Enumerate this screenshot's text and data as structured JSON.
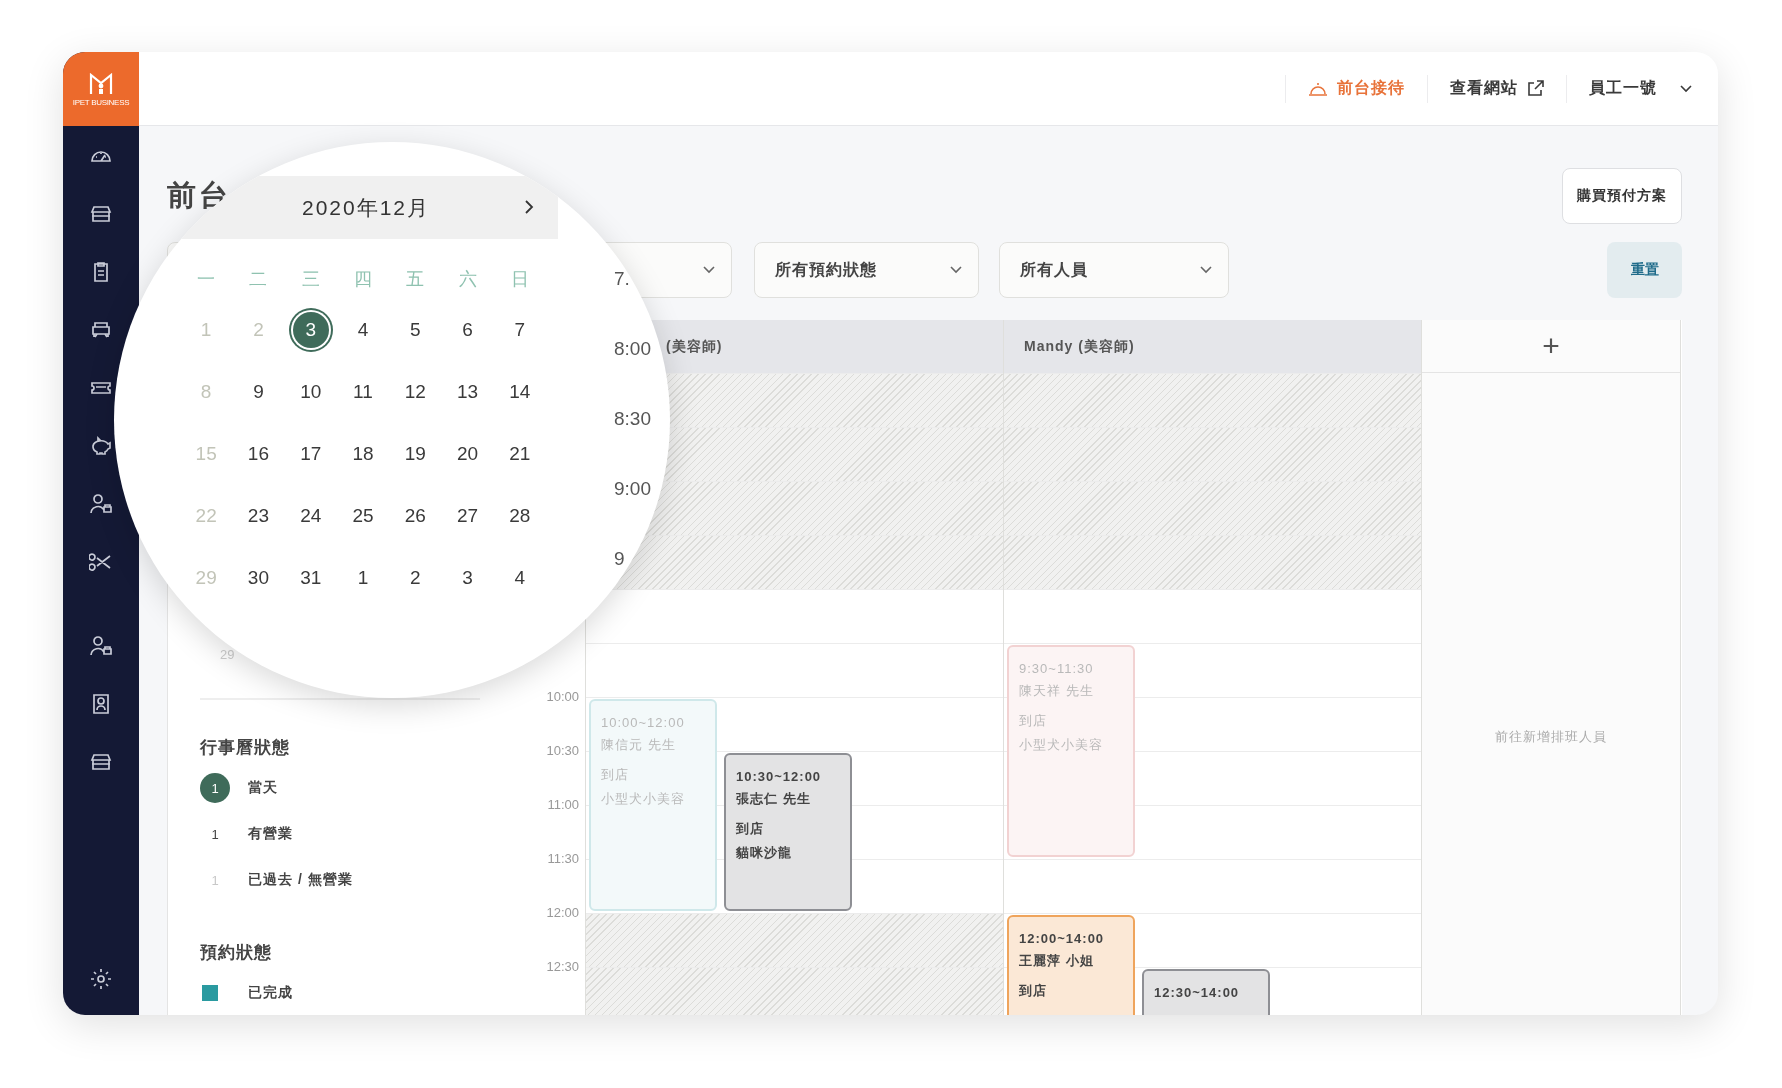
{
  "logo": {
    "caption": "IPET BUSINESS"
  },
  "top_nav": [
    {
      "label": "前台接待",
      "kind": "reception",
      "selected": true
    },
    {
      "label": "查看網站",
      "kind": "external",
      "selected": false
    },
    {
      "label": "員工一號",
      "kind": "account",
      "selected": false
    }
  ],
  "page": {
    "title": "前台",
    "purchase_button": "購買預付方案",
    "reset_button": "重置"
  },
  "filters": [
    {
      "label": "所有預約狀態"
    },
    {
      "label": "所有人員"
    }
  ],
  "mini_calendar_peek": "29",
  "calendar_legend": {
    "title": "行事曆狀態",
    "items": [
      {
        "sample": "1",
        "label": "當天",
        "kind": "today"
      },
      {
        "sample": "1",
        "label": "有營業",
        "kind": "open"
      },
      {
        "sample": "1",
        "label": "已過去 / 無營業",
        "kind": "closed"
      }
    ]
  },
  "booking_legend": {
    "title": "預約狀態",
    "items": [
      {
        "label": "已完成",
        "color": "#2a9aa0"
      }
    ]
  },
  "schedule": {
    "times": [
      "10:00",
      "10:30",
      "11:00",
      "11:30",
      "12:00",
      "12:30"
    ],
    "staff": [
      {
        "header": "(美容師)",
        "blocked_slots": [
          true,
          true,
          true,
          true,
          false,
          false,
          false,
          false,
          false,
          false,
          true,
          true
        ],
        "appointments": [
          {
            "time": "10:00~12:00",
            "lines": [
              "陳信元 先生",
              "到店",
              "小型犬小美容"
            ],
            "color": "#cfe8ea",
            "dimmed": true
          },
          {
            "time": "10:30~12:00",
            "lines": [
              "張志仁 先生",
              "到店",
              "貓咪沙龍"
            ],
            "color": "#8e8f94",
            "dimmed": false
          }
        ]
      },
      {
        "header": "Mandy (美容師)",
        "blocked_slots": [
          true,
          true,
          true,
          true,
          false,
          false,
          false,
          false,
          false,
          false,
          false,
          false
        ],
        "appointments": [
          {
            "time": "9:30~11:30",
            "lines": [
              "陳天祥 先生",
              "到店",
              "小型犬小美容"
            ],
            "color": "#f2d2d2",
            "dimmed": true
          },
          {
            "time": "12:00~14:00",
            "lines": [
              "王麗萍 小姐",
              "到店"
            ],
            "color": "#efa45c",
            "dimmed": false
          },
          {
            "time": "12:30~14:00",
            "color": "#8e8f94",
            "dimmed": false
          }
        ]
      }
    ],
    "add_column": {
      "symbol": "+",
      "hint": "前往新增排班人員"
    }
  },
  "magnifier": {
    "month": "2020年12月",
    "weekdays": [
      "一",
      "二",
      "三",
      "四",
      "五",
      "六",
      "日"
    ],
    "days": [
      {
        "label": "1",
        "today": false,
        "closed": true
      },
      {
        "label": "2",
        "today": false,
        "closed": true
      },
      {
        "label": "3",
        "today": true,
        "closed": false
      },
      {
        "label": "4",
        "today": false,
        "closed": false
      },
      {
        "label": "5",
        "today": false,
        "closed": false
      },
      {
        "label": "6",
        "today": false,
        "closed": false
      },
      {
        "label": "7",
        "today": false,
        "closed": false
      },
      {
        "label": "8",
        "today": false,
        "closed": true
      },
      {
        "label": "9",
        "today": false,
        "closed": false
      },
      {
        "label": "10",
        "today": false,
        "closed": false
      },
      {
        "label": "11",
        "today": false,
        "closed": false
      },
      {
        "label": "12",
        "today": false,
        "closed": false
      },
      {
        "label": "13",
        "today": false,
        "closed": false
      },
      {
        "label": "14",
        "today": false,
        "closed": false
      },
      {
        "label": "15",
        "today": false,
        "closed": true
      },
      {
        "label": "16",
        "today": false,
        "closed": false
      },
      {
        "label": "17",
        "today": false,
        "closed": false
      },
      {
        "label": "18",
        "today": false,
        "closed": false
      },
      {
        "label": "19",
        "today": false,
        "closed": false
      },
      {
        "label": "20",
        "today": false,
        "closed": false
      },
      {
        "label": "21",
        "today": false,
        "closed": false
      },
      {
        "label": "22",
        "today": false,
        "closed": true
      },
      {
        "label": "23",
        "today": false,
        "closed": false
      },
      {
        "label": "24",
        "today": false,
        "closed": false
      },
      {
        "label": "25",
        "today": false,
        "closed": false
      },
      {
        "label": "26",
        "today": false,
        "closed": false
      },
      {
        "label": "27",
        "today": false,
        "closed": false
      },
      {
        "label": "28",
        "today": false,
        "closed": false
      },
      {
        "label": "29",
        "today": false,
        "closed": true
      },
      {
        "label": "30",
        "today": false,
        "closed": false
      },
      {
        "label": "31",
        "today": false,
        "closed": false
      },
      {
        "label": "1",
        "today": false,
        "closed": false
      },
      {
        "label": "2",
        "today": false,
        "closed": false
      },
      {
        "label": "3",
        "today": false,
        "closed": false
      },
      {
        "label": "4",
        "today": false,
        "closed": false
      }
    ],
    "times": [
      "7.",
      "8:00",
      "8:30",
      "9:00",
      "9"
    ]
  }
}
